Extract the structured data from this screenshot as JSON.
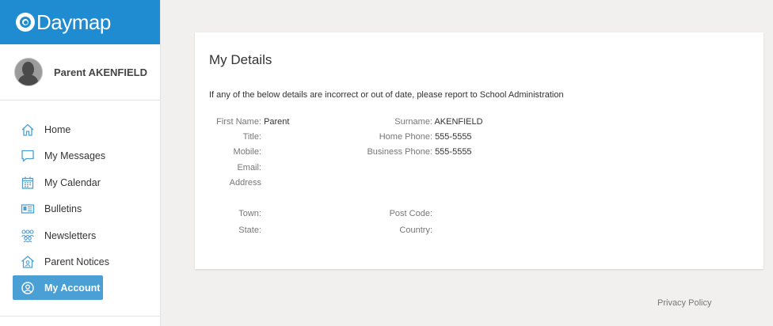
{
  "brand": {
    "name": "Daymap",
    "color": "#1f8bd0"
  },
  "user": {
    "name": "Parent AKENFIELD"
  },
  "nav": [
    {
      "label": "Home",
      "icon": "home-icon"
    },
    {
      "label": "My Messages",
      "icon": "messages-icon"
    },
    {
      "label": "My Calendar",
      "icon": "calendar-icon"
    },
    {
      "label": "Bulletins",
      "icon": "bulletins-icon"
    },
    {
      "label": "Newsletters",
      "icon": "newsletters-icon"
    },
    {
      "label": "Parent Notices",
      "icon": "parent-notices-icon"
    },
    {
      "label": "My Account",
      "icon": "account-icon",
      "active": true
    }
  ],
  "details": {
    "title": "My Details",
    "notice": "If any of the below details are incorrect or out of date, please report to School Administration",
    "first_name_label": "First Name:",
    "first_name": "Parent",
    "surname_label": "Surname:",
    "surname": "AKENFIELD",
    "title_label": "Title:",
    "title_value": "",
    "home_phone_label": "Home Phone:",
    "home_phone": "555-5555",
    "mobile_label": "Mobile:",
    "mobile": "",
    "business_phone_label": "Business Phone:",
    "business_phone": "555-5555",
    "email_label": "Email:",
    "email": "",
    "address_label": "Address",
    "address": "",
    "town_label": "Town:",
    "town": "",
    "post_code_label": "Post Code:",
    "post_code": "",
    "state_label": "State:",
    "state": "",
    "country_label": "Country:",
    "country": ""
  },
  "footer": {
    "privacy": "Privacy Policy"
  },
  "colors": {
    "accent": "#4a9fd4",
    "background": "#f1f0ee"
  }
}
